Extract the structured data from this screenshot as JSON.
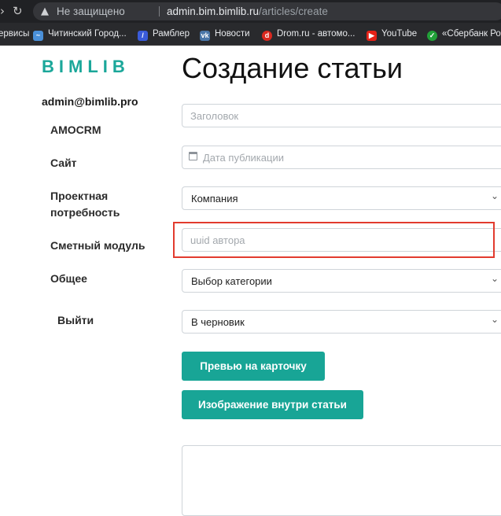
{
  "browser": {
    "security_text": "Не защищено",
    "url_host": "admin.bim.bimlib.ru",
    "url_path": "/articles/create",
    "bookmarks": [
      {
        "label": "ервисы",
        "icon": "apps-icon",
        "color": "#5f6368"
      },
      {
        "label": "Читинский Город...",
        "icon": "city-icon",
        "color": "#4a90d9"
      },
      {
        "label": "Рамблер",
        "icon": "rambler-icon",
        "color": "#3a5bd9"
      },
      {
        "label": "Новости",
        "icon": "vk-icon",
        "color": "#4a76a8"
      },
      {
        "label": "Drom.ru - автомо...",
        "icon": "drom-icon",
        "color": "#d9281f"
      },
      {
        "label": "YouTube",
        "icon": "youtube-icon",
        "color": "#e62117"
      },
      {
        "label": "«Сбербанк Ро",
        "icon": "sberbank-icon",
        "color": "#21a038"
      }
    ]
  },
  "sidebar": {
    "logo": "BIMLIB",
    "user": "admin@bimlib.pro",
    "items": [
      {
        "label": "AMOCRM"
      },
      {
        "label": "Сайт"
      },
      {
        "label": "Проектная потребность"
      },
      {
        "label": "Сметный модуль"
      },
      {
        "label": "Общее"
      }
    ],
    "logout": "Выйти"
  },
  "main": {
    "title": "Создание статьи",
    "fields": {
      "title_placeholder": "Заголовок",
      "date_placeholder": "Дата публикации",
      "company_value": "Компания",
      "author_placeholder": "uuid автора",
      "category_value": "Выбор категории",
      "status_value": "В черновик"
    },
    "buttons": {
      "preview": "Превью на карточку",
      "image_inside": "Изображение внутри статьи"
    },
    "accent_color": "#18a596",
    "highlight_color": "#e23b2e"
  }
}
